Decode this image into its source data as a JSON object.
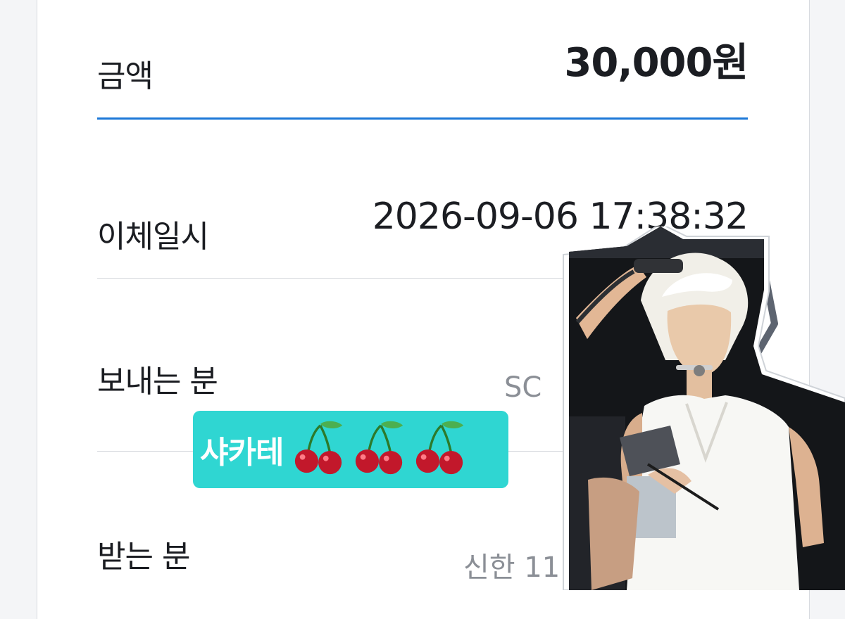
{
  "transfer": {
    "amount_label": "금액",
    "amount_value": "30,000원",
    "datetime_label": "이체일시",
    "datetime_value": "2026-09-06 17:38:32",
    "sender_label": "보내는 분",
    "sender_value_partial": "SC",
    "receiver_label": "받는 분",
    "receiver_value_partial": "신한 11"
  },
  "sticker": {
    "text": "샤카테"
  },
  "photo": {
    "icon": "person-photo-sticker"
  },
  "colors": {
    "accent_line": "#1c78d8",
    "sticker_bg": "#2fd6d2"
  }
}
